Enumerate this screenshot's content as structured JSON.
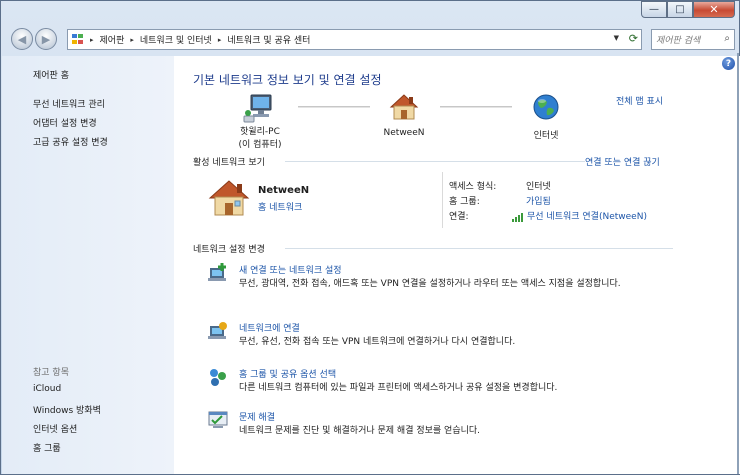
{
  "window": {
    "caption_minimize": "—",
    "caption_maximize": "□",
    "caption_close": "✕"
  },
  "nav": {
    "back_glyph": "◀",
    "forward_glyph": "▶",
    "breadcrumbs": [
      "제어판",
      "네트워크 및 인터넷",
      "네트워크 및 공유 센터"
    ],
    "crumb_separator": "▸",
    "dropdown_glyph": "▼",
    "refresh_glyph": "⟳",
    "search_placeholder": "제어판 검색",
    "search_icon": "⌕"
  },
  "sidebar": {
    "home": "제어판 홈",
    "items": [
      "무선 네트워크 관리",
      "어댑터 설정 변경",
      "고급 공유 설정 변경"
    ],
    "see_also_title": "참고 항목",
    "see_also": [
      "iCloud",
      "Windows 방화벽",
      "인터넷 옵션",
      "홈 그룹"
    ]
  },
  "main": {
    "help_glyph": "?",
    "title": "기본 네트워크 정보 보기 및 연결 설정",
    "map_link": "전체 맵 표시",
    "nodes": {
      "pc_name": "핫윌리-PC",
      "pc_sub": "(이 컴퓨터)",
      "network_name": "NetweeN",
      "internet": "인터넷"
    },
    "active_section_title": "활성 네트워크 보기",
    "connect_link": "연결 또는 연결 끊기",
    "active_network": {
      "name": "NetweeN",
      "type": "홈 네트워크",
      "access_type_label": "액세스 형식:",
      "access_type_value": "인터넷",
      "homegroup_label": "홈 그룹:",
      "homegroup_value": "가입됨",
      "connection_label": "연결:",
      "connection_value": "무선 네트워크 연결(NetweeN)"
    },
    "settings_section_title": "네트워크 설정 변경",
    "tasks": [
      {
        "title": "새 연결 또는 네트워크 설정",
        "desc": "무선, 광대역, 전화 접속, 애드혹 또는 VPN 연결을 설정하거나 라우터 또는 액세스 지점을 설정합니다."
      },
      {
        "title": "네트워크에 연결",
        "desc": "무선, 유선, 전화 접속 또는 VPN 네트워크에 연결하거나 다시 연결합니다."
      },
      {
        "title": "홈 그룹 및 공유 옵션 선택",
        "desc": "다른 네트워크 컴퓨터에 있는 파일과 프린터에 액세스하거나 공유 설정을 변경합니다."
      },
      {
        "title": "문제 해결",
        "desc": "네트워크 문제를 진단 및 해결하거나 문제 해결 정보를 얻습니다."
      }
    ]
  },
  "colors": {
    "link": "#1d55a8",
    "title": "#1e3c8c",
    "sidebar_bg": "#e3ecf7"
  }
}
